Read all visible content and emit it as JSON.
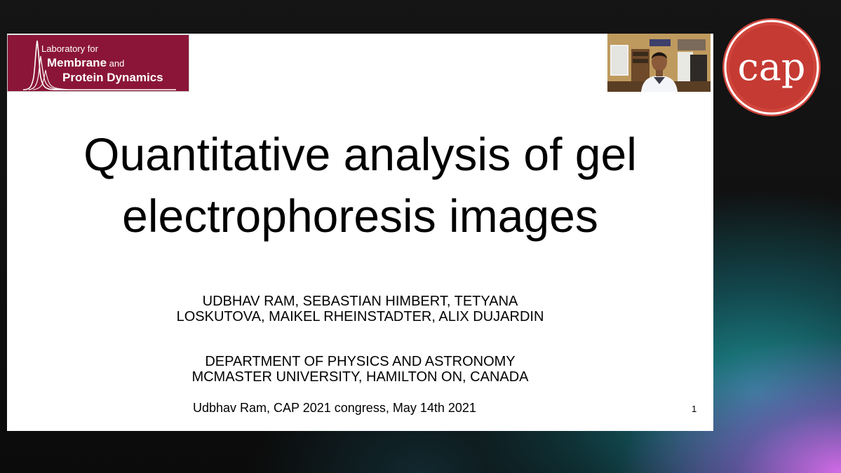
{
  "logo": {
    "line1": "Laboratory for",
    "line2_bold": "Membrane",
    "line2_small": " and",
    "line3": "Protein Dynamics"
  },
  "slide": {
    "title_line1": "Quantitative analysis of gel",
    "title_line2": "electrophoresis images",
    "authors_line1": "UDBHAV RAM, SEBASTIAN HIMBERT, TETYANA",
    "authors_line2": "LOSKUTOVA, MAIKEL RHEINSTADTER, ALIX DUJARDIN",
    "affiliation_line1": "DEPARTMENT OF PHYSICS AND ASTRONOMY",
    "affiliation_line2": "MCMASTER UNIVERSITY, HAMILTON ON, CANADA",
    "footer": "Udbhav Ram, CAP 2021 congress, May 14th 2021",
    "page_number": "1"
  },
  "cap_logo": {
    "text": "cap"
  },
  "colors": {
    "lab_logo_bg": "#8b1538",
    "cap_red": "#d0453c",
    "slide_bg": "#ffffff"
  }
}
